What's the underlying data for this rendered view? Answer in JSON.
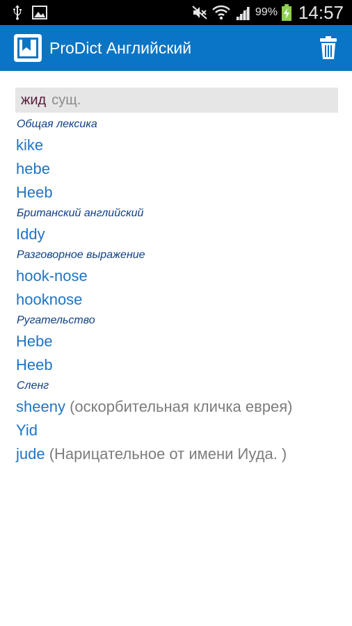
{
  "status_bar": {
    "battery_percent": "99%",
    "time": "14:57",
    "icons": [
      "usb-icon",
      "image-icon",
      "mute-icon",
      "wifi-icon",
      "signal-icon",
      "battery-charging-icon"
    ]
  },
  "app_bar": {
    "title": "ProDict Английский",
    "logo_icon": "bookmark-book-icon",
    "delete_icon": "trash-icon",
    "color": "#0b75c5"
  },
  "headword": {
    "word": "жид",
    "pos": "сущ."
  },
  "sections": [
    {
      "category": "Общая лексика",
      "terms": [
        {
          "term": "kike",
          "note": ""
        },
        {
          "term": "hebe",
          "note": ""
        },
        {
          "term": "Heeb",
          "note": ""
        }
      ]
    },
    {
      "category": "Британский английский",
      "terms": [
        {
          "term": "Iddy",
          "note": ""
        }
      ]
    },
    {
      "category": "Разговорное выражение",
      "terms": [
        {
          "term": "hook-nose",
          "note": ""
        },
        {
          "term": "hooknose",
          "note": ""
        }
      ]
    },
    {
      "category": "Ругательство",
      "terms": [
        {
          "term": "Hebe",
          "note": ""
        },
        {
          "term": "Heeb",
          "note": ""
        }
      ]
    },
    {
      "category": "Сленг",
      "terms": [
        {
          "term": "sheeny",
          "note": "(оскорбительная кличка еврея)"
        },
        {
          "term": "Yid",
          "note": ""
        },
        {
          "term": "jude",
          "note": "(Нарицательное от имени Иуда. )"
        }
      ]
    }
  ]
}
